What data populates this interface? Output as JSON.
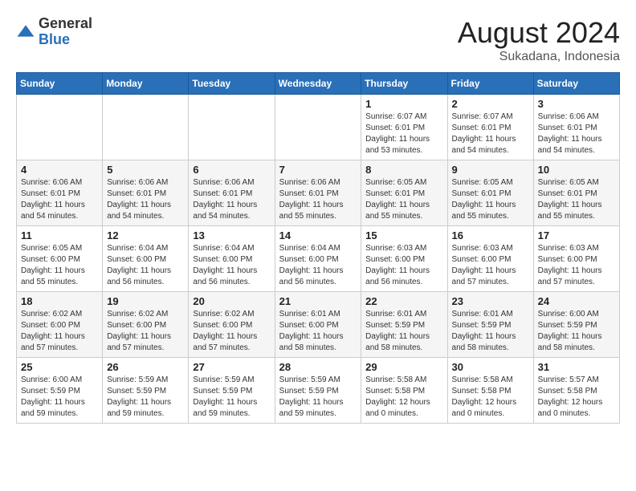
{
  "logo": {
    "general": "General",
    "blue": "Blue"
  },
  "title": {
    "month_year": "August 2024",
    "location": "Sukadana, Indonesia"
  },
  "header": {
    "days": [
      "Sunday",
      "Monday",
      "Tuesday",
      "Wednesday",
      "Thursday",
      "Friday",
      "Saturday"
    ]
  },
  "weeks": [
    {
      "cells": [
        {
          "day": "",
          "info": ""
        },
        {
          "day": "",
          "info": ""
        },
        {
          "day": "",
          "info": ""
        },
        {
          "day": "",
          "info": ""
        },
        {
          "day": "1",
          "info": "Sunrise: 6:07 AM\nSunset: 6:01 PM\nDaylight: 11 hours and 53 minutes."
        },
        {
          "day": "2",
          "info": "Sunrise: 6:07 AM\nSunset: 6:01 PM\nDaylight: 11 hours and 54 minutes."
        },
        {
          "day": "3",
          "info": "Sunrise: 6:06 AM\nSunset: 6:01 PM\nDaylight: 11 hours and 54 minutes."
        }
      ]
    },
    {
      "cells": [
        {
          "day": "4",
          "info": "Sunrise: 6:06 AM\nSunset: 6:01 PM\nDaylight: 11 hours and 54 minutes."
        },
        {
          "day": "5",
          "info": "Sunrise: 6:06 AM\nSunset: 6:01 PM\nDaylight: 11 hours and 54 minutes."
        },
        {
          "day": "6",
          "info": "Sunrise: 6:06 AM\nSunset: 6:01 PM\nDaylight: 11 hours and 54 minutes."
        },
        {
          "day": "7",
          "info": "Sunrise: 6:06 AM\nSunset: 6:01 PM\nDaylight: 11 hours and 55 minutes."
        },
        {
          "day": "8",
          "info": "Sunrise: 6:05 AM\nSunset: 6:01 PM\nDaylight: 11 hours and 55 minutes."
        },
        {
          "day": "9",
          "info": "Sunrise: 6:05 AM\nSunset: 6:01 PM\nDaylight: 11 hours and 55 minutes."
        },
        {
          "day": "10",
          "info": "Sunrise: 6:05 AM\nSunset: 6:01 PM\nDaylight: 11 hours and 55 minutes."
        }
      ]
    },
    {
      "cells": [
        {
          "day": "11",
          "info": "Sunrise: 6:05 AM\nSunset: 6:00 PM\nDaylight: 11 hours and 55 minutes."
        },
        {
          "day": "12",
          "info": "Sunrise: 6:04 AM\nSunset: 6:00 PM\nDaylight: 11 hours and 56 minutes."
        },
        {
          "day": "13",
          "info": "Sunrise: 6:04 AM\nSunset: 6:00 PM\nDaylight: 11 hours and 56 minutes."
        },
        {
          "day": "14",
          "info": "Sunrise: 6:04 AM\nSunset: 6:00 PM\nDaylight: 11 hours and 56 minutes."
        },
        {
          "day": "15",
          "info": "Sunrise: 6:03 AM\nSunset: 6:00 PM\nDaylight: 11 hours and 56 minutes."
        },
        {
          "day": "16",
          "info": "Sunrise: 6:03 AM\nSunset: 6:00 PM\nDaylight: 11 hours and 57 minutes."
        },
        {
          "day": "17",
          "info": "Sunrise: 6:03 AM\nSunset: 6:00 PM\nDaylight: 11 hours and 57 minutes."
        }
      ]
    },
    {
      "cells": [
        {
          "day": "18",
          "info": "Sunrise: 6:02 AM\nSunset: 6:00 PM\nDaylight: 11 hours and 57 minutes."
        },
        {
          "day": "19",
          "info": "Sunrise: 6:02 AM\nSunset: 6:00 PM\nDaylight: 11 hours and 57 minutes."
        },
        {
          "day": "20",
          "info": "Sunrise: 6:02 AM\nSunset: 6:00 PM\nDaylight: 11 hours and 57 minutes."
        },
        {
          "day": "21",
          "info": "Sunrise: 6:01 AM\nSunset: 6:00 PM\nDaylight: 11 hours and 58 minutes."
        },
        {
          "day": "22",
          "info": "Sunrise: 6:01 AM\nSunset: 5:59 PM\nDaylight: 11 hours and 58 minutes."
        },
        {
          "day": "23",
          "info": "Sunrise: 6:01 AM\nSunset: 5:59 PM\nDaylight: 11 hours and 58 minutes."
        },
        {
          "day": "24",
          "info": "Sunrise: 6:00 AM\nSunset: 5:59 PM\nDaylight: 11 hours and 58 minutes."
        }
      ]
    },
    {
      "cells": [
        {
          "day": "25",
          "info": "Sunrise: 6:00 AM\nSunset: 5:59 PM\nDaylight: 11 hours and 59 minutes."
        },
        {
          "day": "26",
          "info": "Sunrise: 5:59 AM\nSunset: 5:59 PM\nDaylight: 11 hours and 59 minutes."
        },
        {
          "day": "27",
          "info": "Sunrise: 5:59 AM\nSunset: 5:59 PM\nDaylight: 11 hours and 59 minutes."
        },
        {
          "day": "28",
          "info": "Sunrise: 5:59 AM\nSunset: 5:59 PM\nDaylight: 11 hours and 59 minutes."
        },
        {
          "day": "29",
          "info": "Sunrise: 5:58 AM\nSunset: 5:58 PM\nDaylight: 12 hours and 0 minutes."
        },
        {
          "day": "30",
          "info": "Sunrise: 5:58 AM\nSunset: 5:58 PM\nDaylight: 12 hours and 0 minutes."
        },
        {
          "day": "31",
          "info": "Sunrise: 5:57 AM\nSunset: 5:58 PM\nDaylight: 12 hours and 0 minutes."
        }
      ]
    }
  ]
}
